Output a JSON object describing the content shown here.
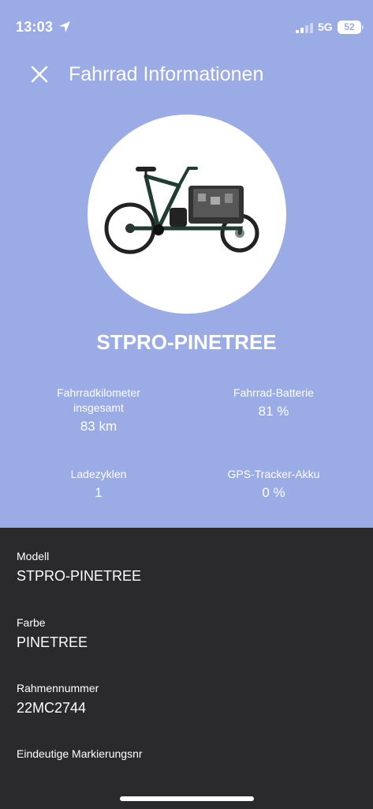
{
  "status_bar": {
    "time": "13:03",
    "network": "5G",
    "battery": "52"
  },
  "header": {
    "title": "Fahrrad Informationen"
  },
  "bike": {
    "name": "STPRO-PINETREE"
  },
  "stats": {
    "km_label_line1": "Fahrradkilometer",
    "km_label_line2": "insgesamt",
    "km_value": "83 km",
    "battery_label": "Fahrrad-Batterie",
    "battery_value": "81 %",
    "cycles_label": "Ladezyklen",
    "cycles_value": "1",
    "gps_label": "GPS-Tracker-Akku",
    "gps_value": "0 %"
  },
  "details": {
    "model_label": "Modell",
    "model_value": "STPRO-PINETREE",
    "color_label": "Farbe",
    "color_value": "PINETREE",
    "frame_label": "Rahmennummer",
    "frame_value": "22MC2744",
    "marking_label": "Eindeutige Markierungsnr"
  },
  "colors": {
    "header_bg": "#9aabe6",
    "panel_bg": "#2a2a2c",
    "bike_frame": "#1f3d33"
  }
}
